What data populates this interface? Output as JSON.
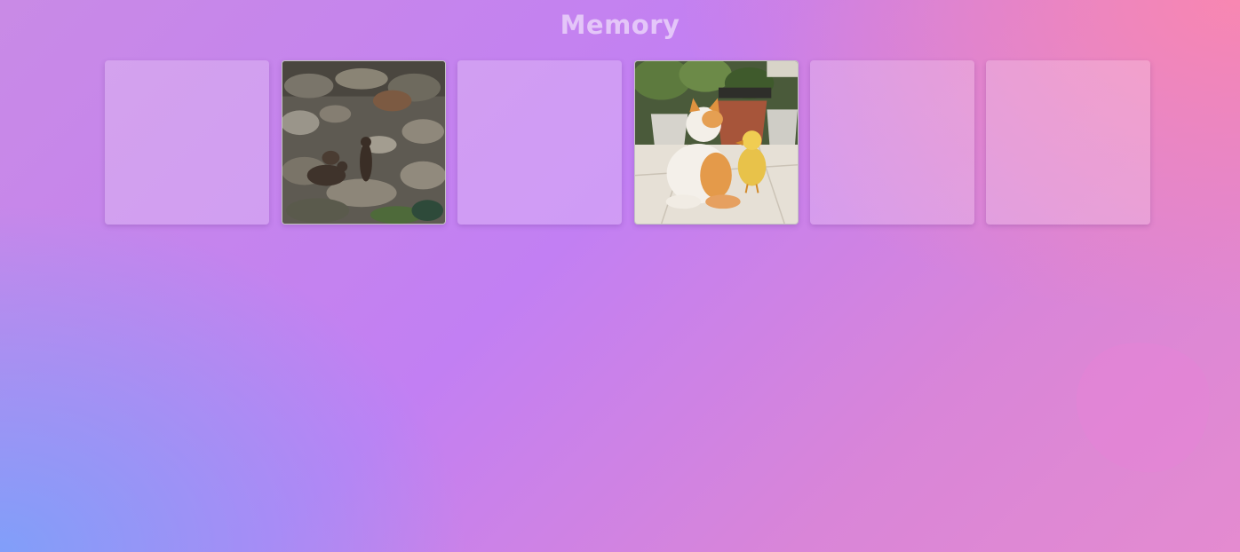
{
  "game": {
    "title": "Memory"
  },
  "cards": [
    {
      "state": "face-down",
      "image": ""
    },
    {
      "state": "face-up",
      "image": "otters-on-rocks"
    },
    {
      "state": "face-down",
      "image": ""
    },
    {
      "state": "face-up",
      "image": "cat-and-duckling"
    },
    {
      "state": "face-down",
      "image": ""
    },
    {
      "state": "face-down",
      "image": ""
    }
  ],
  "colors": {
    "background_top_right": "#f587b3",
    "background_center": "#c27ff3",
    "background_bottom_left": "#7fa0f8",
    "title": "#f0c8f0"
  }
}
